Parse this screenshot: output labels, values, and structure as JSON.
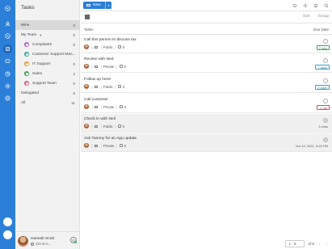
{
  "rail": {
    "icons": [
      "app-menu-icon",
      "contacts-icon",
      "calls-icon",
      "tasks-icon",
      "messages-icon",
      "pipeline-icon",
      "settings-icon",
      "help-icon"
    ],
    "accent": "#2b7fd9"
  },
  "sidebar": {
    "title": "Tasks",
    "items": [
      {
        "label": "Mine",
        "count": "6"
      },
      {
        "label": "My Team",
        "count": "0"
      },
      {
        "label": "Complaints",
        "count": "0",
        "color": "#b061c4"
      },
      {
        "label": "Customer Support Man...",
        "count": "",
        "color": "#3aa5a0"
      },
      {
        "label": "IT Support",
        "count": "0",
        "color": "#e89a3c"
      },
      {
        "label": "Sales",
        "count": "2",
        "color": "#3c9e4e"
      },
      {
        "label": "Support Team",
        "count": "0",
        "color": "#d65a8a"
      },
      {
        "label": "Delegated",
        "count": "0"
      },
      {
        "label": "All",
        "count": "11"
      }
    ],
    "user": {
      "name": "Hannah Scott",
      "sub": "221 B H..."
    }
  },
  "toolbar": {
    "new_label": "New",
    "sort_label": "Sort",
    "group_label": "Group"
  },
  "columns": {
    "tasks": "Tasks",
    "due": "Due Date"
  },
  "tasks": [
    {
      "title": "Call this person to discuss tax",
      "privacy": "Public",
      "comments": "0",
      "due": "2 wks",
      "due_style": "green",
      "done": false
    },
    {
      "title": "Review with Ned",
      "privacy": "Private",
      "comments": "0",
      "due": "7 days",
      "due_style": "blue",
      "done": false
    },
    {
      "title": "Follow up here!",
      "privacy": "Public",
      "comments": "2",
      "due": "5 days",
      "due_style": "blue",
      "done": false
    },
    {
      "title": "Call customer",
      "privacy": "Private",
      "comments": "0",
      "due": "-1 wk",
      "due_style": "red",
      "done": false
    },
    {
      "title": "Check in with Neil",
      "privacy": "Public",
      "comments": "0",
      "due": "3 mins",
      "due_style": "plain",
      "done": true
    },
    {
      "title": "Ask Tammy for an App update",
      "privacy": "Private",
      "comments": "0",
      "due": "Oct 14, 2021, 5:20 PM",
      "due_style": "plain",
      "done": true
    }
  ],
  "pager": {
    "range": "1 - 6",
    "of": "of 6"
  }
}
